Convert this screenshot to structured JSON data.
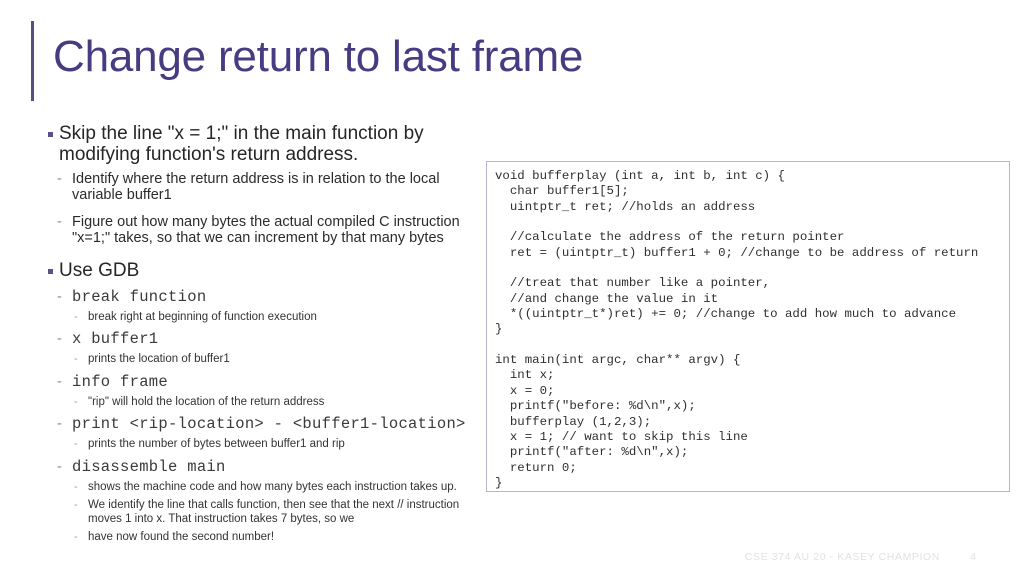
{
  "slide": {
    "title": "Change return to last frame",
    "accent_color": "#564f82",
    "title_color": "#473b81"
  },
  "body": {
    "bullets": [
      {
        "level": 1,
        "text": "Skip the line \"x = 1;\" in the main function by modifying function's return address."
      },
      {
        "level": 2,
        "text": "Identify where the return address is in relation to the local variable buffer1"
      },
      {
        "level": 2,
        "text": "Figure out how many bytes the actual compiled C instruction \"x=1;\" takes, so that we can increment by that many bytes"
      },
      {
        "level": 1,
        "text": "Use GDB"
      },
      {
        "level": 2,
        "mono": true,
        "text": "break function"
      },
      {
        "level": 3,
        "text": "break right at beginning of function execution"
      },
      {
        "level": 2,
        "mono": true,
        "text": "x buffer1"
      },
      {
        "level": 3,
        "text": "prints the location of buffer1"
      },
      {
        "level": 2,
        "mono": true,
        "text": "info frame"
      },
      {
        "level": 3,
        "text": "\"rip\" will hold the location of the return address"
      },
      {
        "level": 2,
        "mono": true,
        "text": "print <rip-location> - <buffer1-location>"
      },
      {
        "level": 3,
        "text": "prints the number of bytes between buffer1 and rip"
      },
      {
        "level": 2,
        "mono": true,
        "text": "disassemble main"
      },
      {
        "level": 3,
        "text": "shows the machine code and how many bytes each instruction takes up."
      },
      {
        "level": 3,
        "text": "We identify the line that calls function, then see that the next // instruction moves 1 into x. That instruction takes 7 bytes, so we"
      },
      {
        "level": 3,
        "text": "have now found the second number!"
      }
    ]
  },
  "code_panel": {
    "border_color": "#b9b3d6",
    "language": "c",
    "code": "void bufferplay (int a, int b, int c) {\n  char buffer1[5];\n  uintptr_t ret; //holds an address\n\n  //calculate the address of the return pointer\n  ret = (uintptr_t) buffer1 + 0; //change to be address of return\n\n  //treat that number like a pointer,\n  //and change the value in it\n  *((uintptr_t*)ret) += 0; //change to add how much to advance\n}\n\nint main(int argc, char** argv) {\n  int x;\n  x = 0;\n  printf(\"before: %d\\n\",x);\n  bufferplay (1,2,3);\n  x = 1; // want to skip this line\n  printf(\"after: %d\\n\",x);\n  return 0;\n}"
  },
  "footer": {
    "course_text": "CSE 374 AU 20 - KASEY CHAMPION",
    "page_number": "4"
  }
}
